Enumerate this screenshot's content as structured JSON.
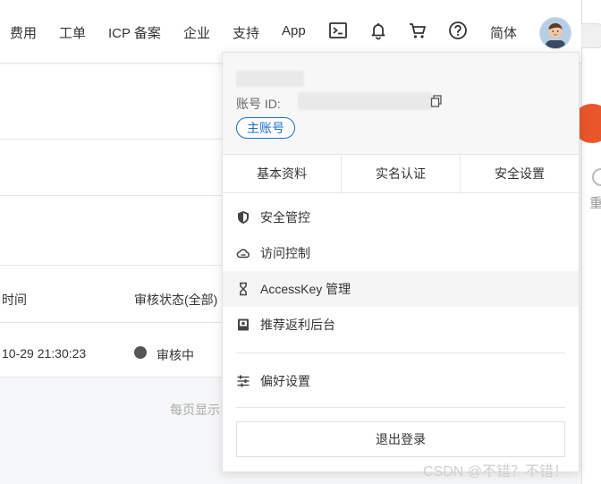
{
  "nav": {
    "items": [
      "费用",
      "工单",
      "ICP 备案",
      "企业",
      "支持",
      "App"
    ],
    "icons": [
      "terminal-icon",
      "bell-icon",
      "cart-icon",
      "help-icon"
    ],
    "language": "简体"
  },
  "table": {
    "col_time": "时间",
    "col_status": "审核状态(全部)",
    "row_time": "10-29 21:30:23",
    "row_status": "审核中",
    "pager": "每页显示"
  },
  "side": {
    "cut_text": "重"
  },
  "dropdown": {
    "account_label": "账号 ID:",
    "main_account_badge": "主账号",
    "tabs": [
      "基本资料",
      "实名认证",
      "安全设置"
    ],
    "menu": [
      {
        "label": "安全管控",
        "icon": "shield-icon"
      },
      {
        "label": "访问控制",
        "icon": "cloud-icon"
      },
      {
        "label": "AccessKey 管理",
        "icon": "key-icon"
      },
      {
        "label": "推荐返利后台",
        "icon": "gift-icon"
      }
    ],
    "preferences": {
      "label": "偏好设置",
      "icon": "sliders-icon"
    },
    "logout": "退出登录"
  },
  "watermark": "CSDN @不错？不错！"
}
